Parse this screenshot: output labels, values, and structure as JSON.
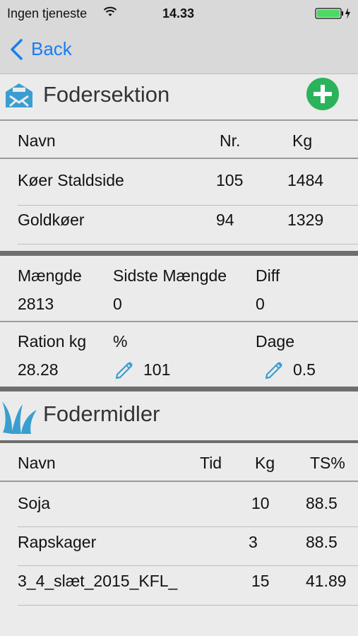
{
  "status": {
    "carrier": "Ingen tjeneste",
    "time": "14.33"
  },
  "nav": {
    "back_label": "Back"
  },
  "feed_section": {
    "title": "Fodersektion",
    "columns": {
      "name": "Navn",
      "nr": "Nr.",
      "kg": "Kg"
    },
    "rows": [
      {
        "name": "Køer Staldside",
        "nr": "105",
        "kg": "1484"
      },
      {
        "name": "Goldkøer",
        "nr": "94",
        "kg": "1329"
      }
    ]
  },
  "summary": {
    "amount_label": "Mængde",
    "last_amount_label": "Sidste Mængde",
    "diff_label": "Diff",
    "amount": "2813",
    "last_amount": "0",
    "diff": "0",
    "ration_label": "Ration kg",
    "percent_label": "%",
    "days_label": "Dage",
    "ration": "28.28",
    "percent": "101",
    "days": "0.5"
  },
  "feedstuffs": {
    "title": "Fodermidler",
    "columns": {
      "name": "Navn",
      "time": "Tid",
      "kg": "Kg",
      "ts": "TS%"
    },
    "rows": [
      {
        "name": "Soja",
        "time": "",
        "kg": "10",
        "ts": "88.5"
      },
      {
        "name": "Rapskager",
        "time": "",
        "kg": "3",
        "ts": "88.5"
      },
      {
        "name": "3_4_slæt_2015_KFL_",
        "time": "",
        "kg": "15",
        "ts": "41.89"
      }
    ]
  },
  "colors": {
    "accent": "#1a7cf2",
    "add": "#2bb35b",
    "icon": "#3a9ed1",
    "battery": "#4cd964"
  },
  "icons": [
    "wifi-icon",
    "battery-icon",
    "back-chevron-icon",
    "feeder-icon",
    "add-icon",
    "pencil-icon",
    "grass-icon"
  ]
}
